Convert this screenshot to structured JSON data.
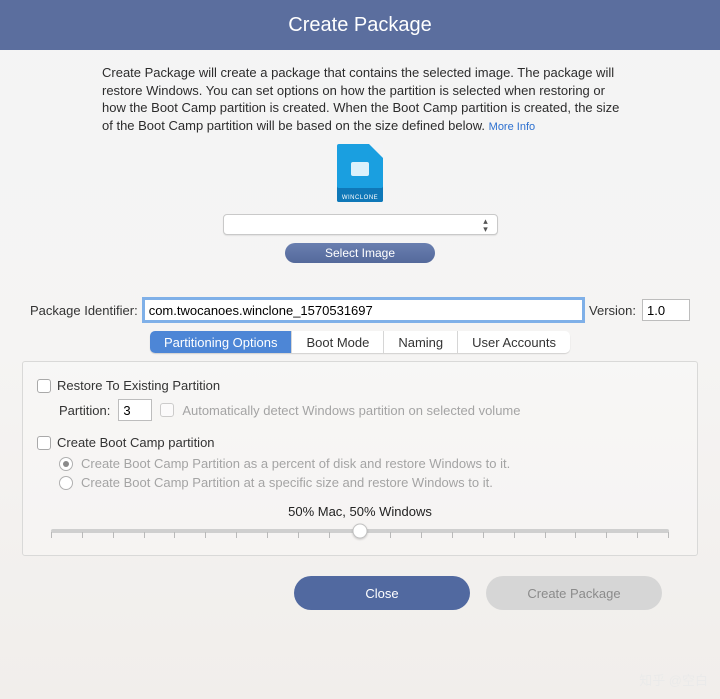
{
  "title": "Create Package",
  "description": "Create Package will create a package that contains the selected image. The package will restore Windows. You can set options on how the partition is selected when restoring or how the Boot Camp partition is created. When the Boot Camp partition is created, the size of the Boot Camp partition will be based on the size defined below.",
  "more_info": "More Info",
  "icon": {
    "name": "winclone-document-icon",
    "caption": "WINCLONE"
  },
  "image_select": {
    "selected": "",
    "button": "Select Image"
  },
  "identifier": {
    "label": "Package Identifier:",
    "value": "com.twocanoes.winclone_1570531697",
    "version_label": "Version:",
    "version_value": "1.0"
  },
  "tabs": [
    "Partitioning Options",
    "Boot Mode",
    "Naming",
    "User Accounts"
  ],
  "active_tab": 0,
  "panel": {
    "restore_existing": {
      "label": "Restore To Existing Partition",
      "checked": false,
      "partition_label": "Partition:",
      "partition_value": "3",
      "auto_detect_label": "Automatically detect Windows partition on selected volume",
      "auto_detect_checked": false
    },
    "create_bootcamp": {
      "label": "Create Boot Camp partition",
      "checked": false,
      "opt1": "Create Boot Camp Partition as a percent of disk and restore Windows to it.",
      "opt1_selected": true,
      "opt2": "Create Boot Camp Partition at a specific size and restore Windows to it.",
      "opt2_selected": false
    },
    "slider": {
      "label": "50% Mac, 50% Windows",
      "percent": 50
    }
  },
  "footer": {
    "close": "Close",
    "create": "Create Package"
  },
  "watermark": "知乎 @空白"
}
